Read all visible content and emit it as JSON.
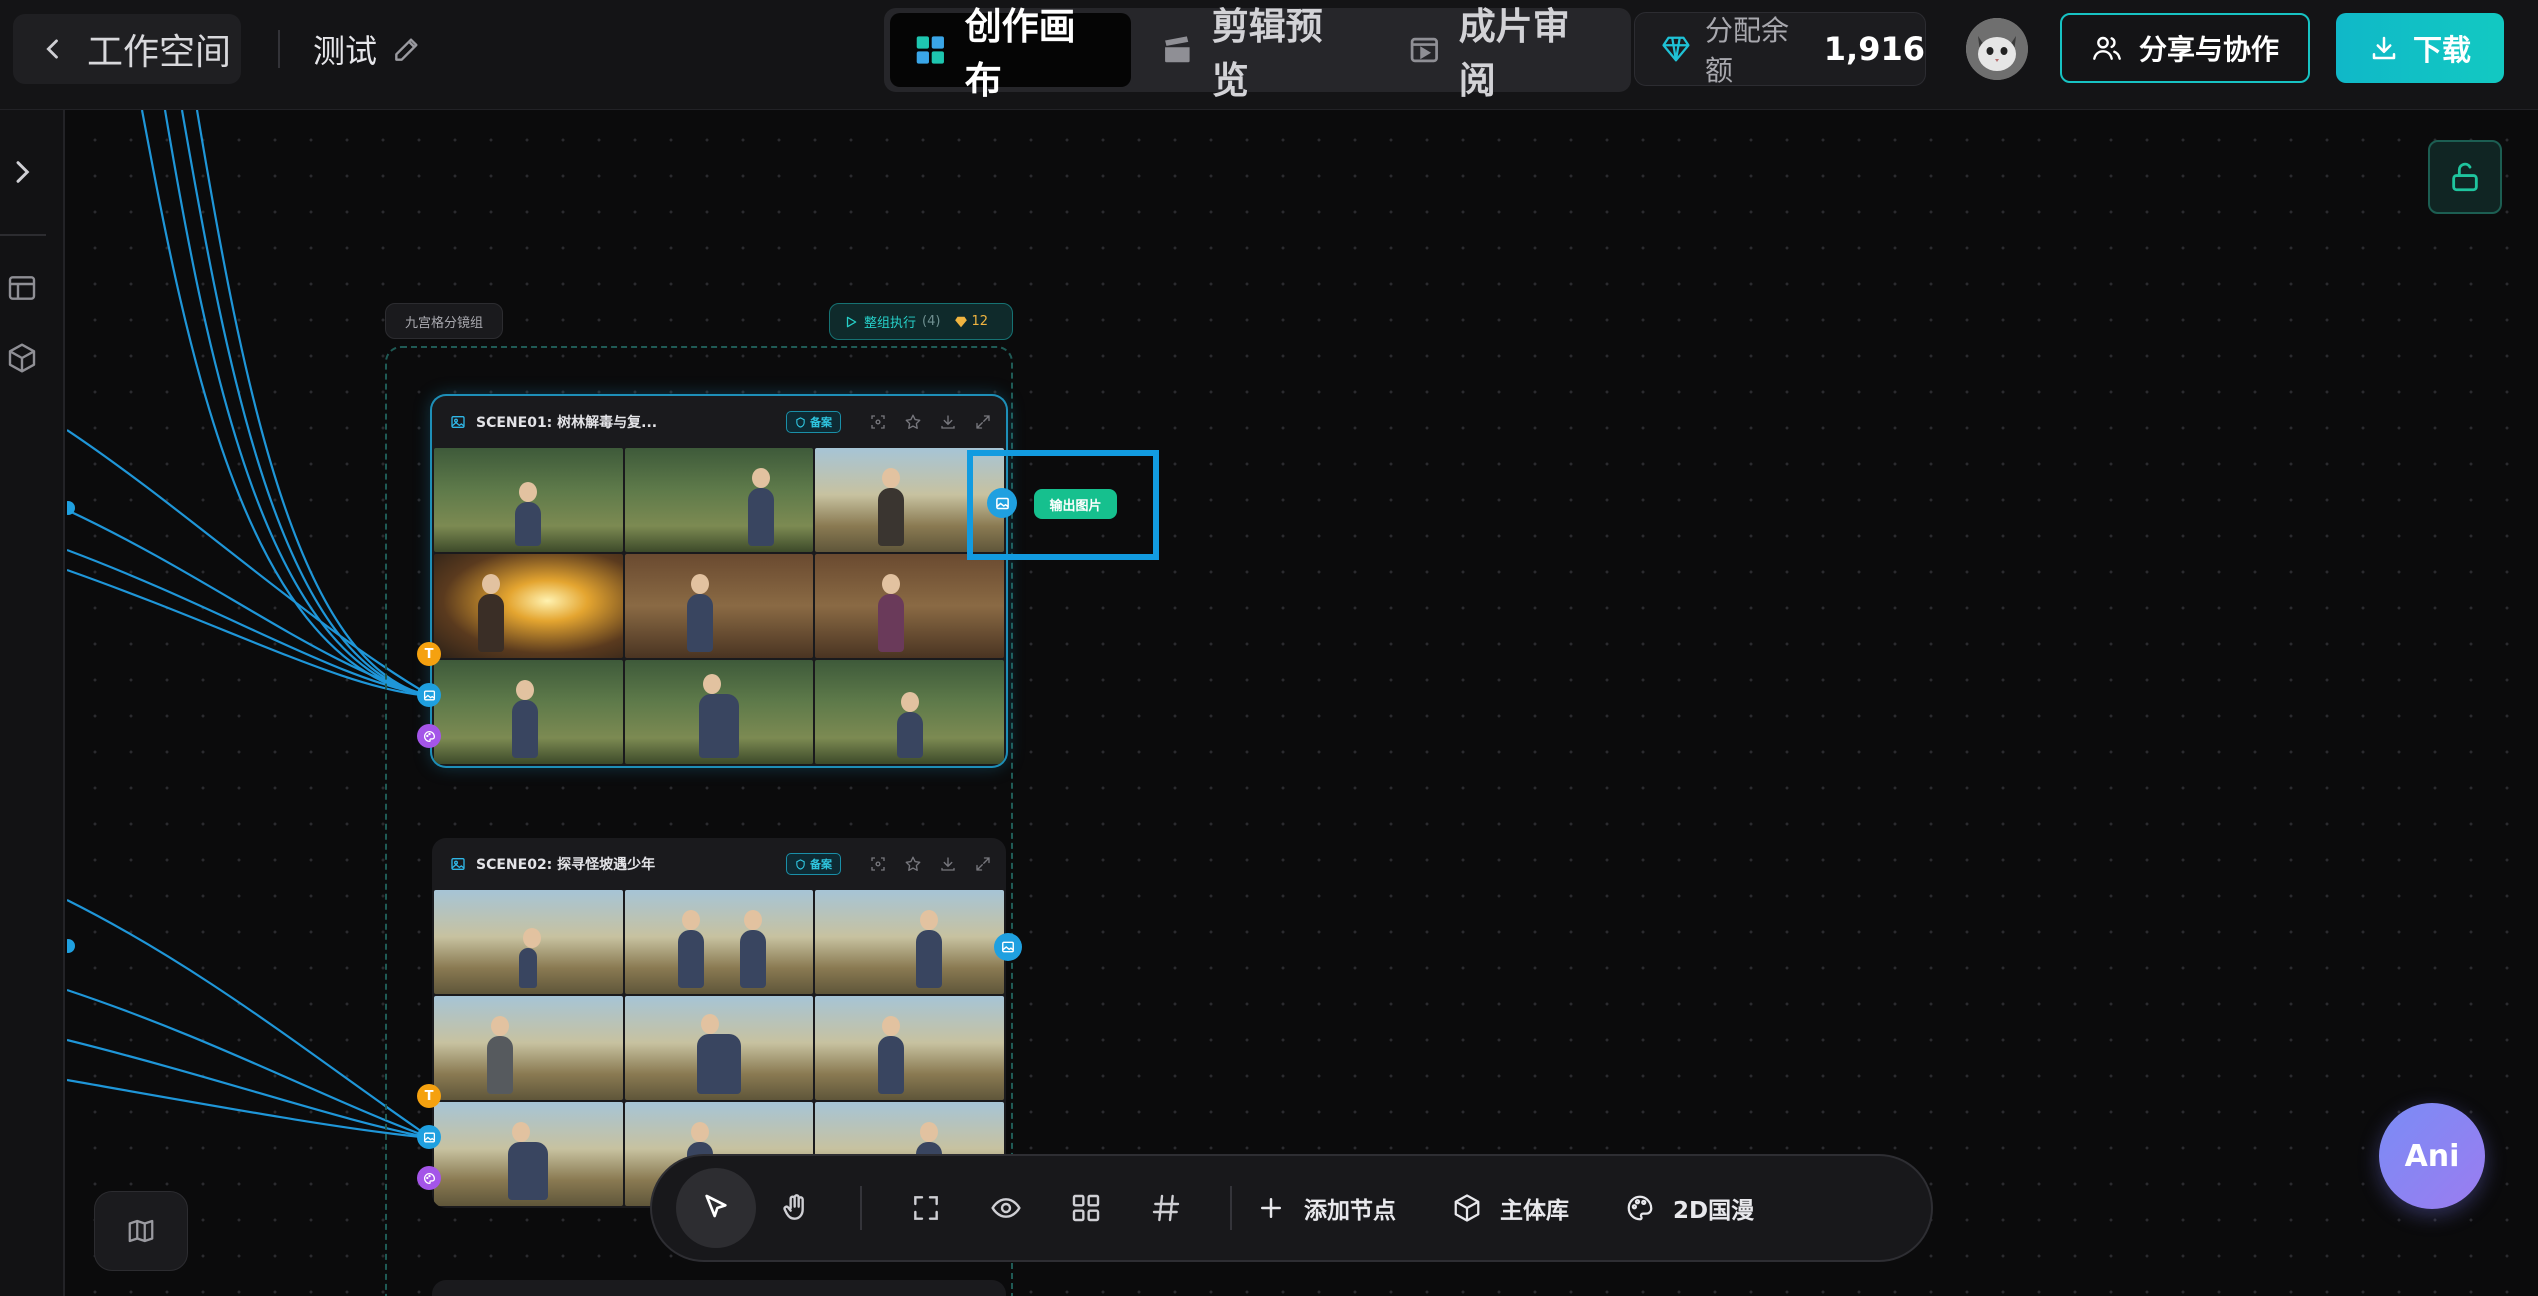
{
  "header": {
    "back_label": "工作空间",
    "project_name": "测试",
    "tabs": [
      {
        "label": "创作画布",
        "active": true
      },
      {
        "label": "剪辑预览",
        "active": false
      },
      {
        "label": "成片审阅",
        "active": false
      }
    ],
    "balance_label": "分配余额",
    "balance_value": "1,916",
    "share_label": "分享与协作",
    "download_label": "下载"
  },
  "canvas": {
    "group": {
      "label": "九宫格分镜组",
      "exec_label": "整组执行",
      "exec_count": "(4)",
      "exec_cost": "12"
    },
    "scenes": [
      {
        "title": "SCENE01: 树林解毒与复...",
        "badge": "备案",
        "cells": [
          "forest",
          "forest",
          "village",
          "flash",
          "interior",
          "interior",
          "forest",
          "forest",
          "forest"
        ]
      },
      {
        "title": "SCENE02: 探寻怪坡遇少年",
        "badge": "备案",
        "cells": [
          "village",
          "village",
          "village",
          "village",
          "village",
          "village",
          "village",
          "village",
          "village"
        ]
      }
    ],
    "output_label": "输出图片",
    "port_text_label": "T"
  },
  "toolbar": {
    "add_node_label": "添加节点",
    "asset_library_label": "主体库",
    "style_label": "2D国漫"
  },
  "assistant_label": "Ani",
  "colors": {
    "accent": "#12c9c2",
    "connector": "#1fa0e0",
    "output_badge": "#16c08e",
    "text_port": "#f5a10f",
    "style_port": "#a455e8"
  }
}
